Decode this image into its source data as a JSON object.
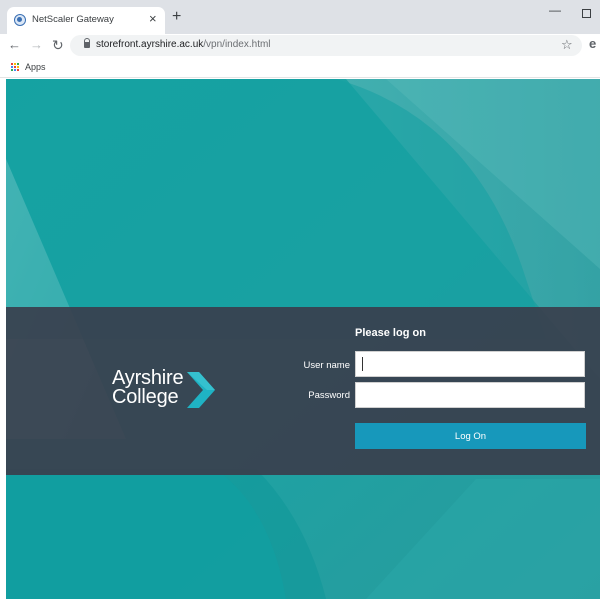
{
  "browser": {
    "tab_title": "NetScaler Gateway",
    "tab_close": "×",
    "new_tab": "+",
    "url_host": "storefront.ayrshire.ac.uk",
    "url_path": "/vpn/index.html",
    "bookmarks_apps_label": "Apps",
    "icons": [
      "netscaler-favicon-icon",
      "back-arrow-icon",
      "forward-arrow-icon",
      "reload-icon",
      "lock-icon",
      "star-icon",
      "profile-icon",
      "apps-grid-icon",
      "minimize-icon",
      "maximize-icon"
    ]
  },
  "logo": {
    "line1": "Ayrshire",
    "line2": "College",
    "chevron_color": "#1fb3c4"
  },
  "login": {
    "title": "Please log on",
    "username_label": "User name",
    "password_label": "Password",
    "username_value": "",
    "password_value": "",
    "submit_label": "Log On",
    "button_color": "#1798bb"
  },
  "colors": {
    "background_teal": "#1fa3a2",
    "band": "#39404d"
  }
}
